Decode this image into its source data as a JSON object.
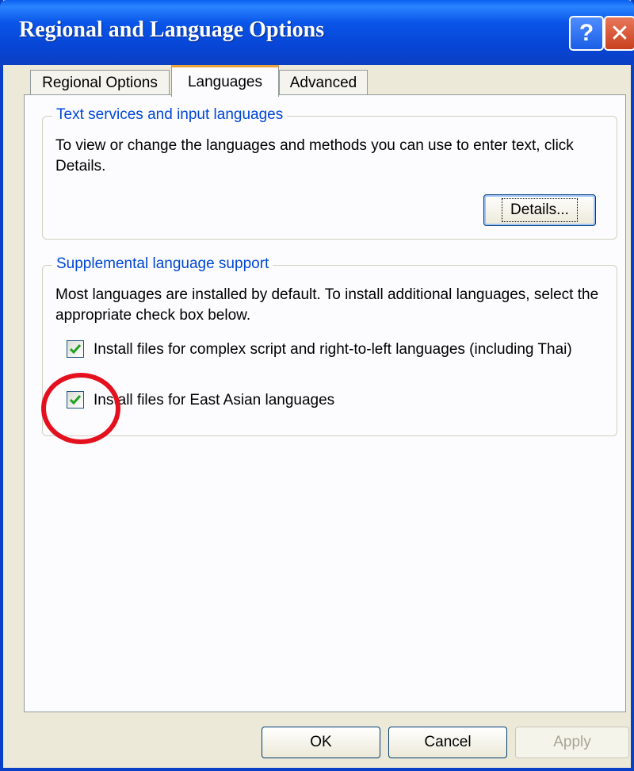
{
  "window": {
    "title": "Regional and Language Options",
    "help_button": "?",
    "close_button": "✕"
  },
  "tabs": [
    {
      "label": "Regional Options",
      "active": false
    },
    {
      "label": "Languages",
      "active": true
    },
    {
      "label": "Advanced",
      "active": false
    }
  ],
  "text_services": {
    "legend": "Text services and input languages",
    "description": "To view or change the languages and methods you can use to enter text, click Details.",
    "details_button": "Details..."
  },
  "supplemental": {
    "legend": "Supplemental language support",
    "description": "Most languages are installed by default. To install additional languages, select the appropriate check box below.",
    "checkboxes": [
      {
        "label": "Install files for complex script and right-to-left languages (including Thai)",
        "checked": true
      },
      {
        "label": "Install files for East Asian languages",
        "checked": true
      }
    ]
  },
  "footer": {
    "ok": "OK",
    "cancel": "Cancel",
    "apply": "Apply"
  },
  "colors": {
    "title_bar": "#0a55e8",
    "legend_text": "#0046d5",
    "annotation": "#e5101e",
    "check": "#21a121"
  }
}
